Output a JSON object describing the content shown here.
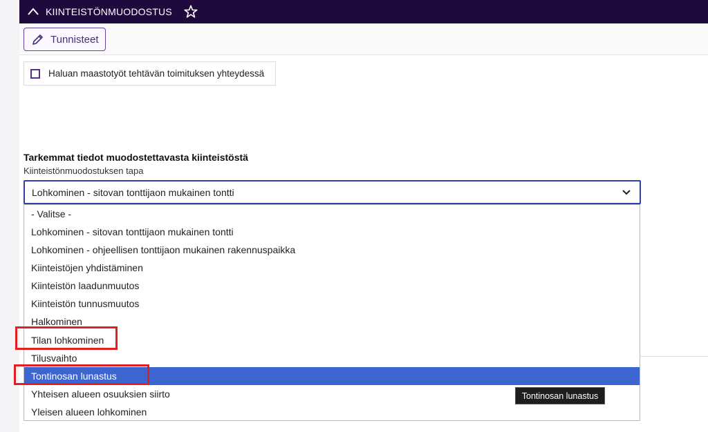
{
  "header": {
    "title": "KIINTEISTÖNMUODOSTUS"
  },
  "toolbar": {
    "tunnisteet_label": "Tunnisteet"
  },
  "checkbox": {
    "label": "Haluan maastotyöt tehtävän toimituksen yhteydessä",
    "checked": false
  },
  "section": {
    "title": "Tarkemmat tiedot muodostettavasta kiinteistöstä",
    "field_label": "Kiinteistönmuodostuksen tapa",
    "selected_value": "Lohkominen - sitovan tonttijaon mukainen tontti"
  },
  "options": [
    "- Valitse -",
    "Lohkominen - sitovan tonttijaon mukainen tontti",
    "Lohkominen - ohjeellisen tonttijaon mukainen rakennuspaikka",
    "Kiinteistöjen yhdistäminen",
    "Kiinteistön laadunmuutos",
    "Kiinteistön tunnusmuutos",
    "Halkominen",
    "Tilan lohkominen",
    "Tilusvaihto",
    "Tontinosan lunastus",
    "Yhteisen alueen osuuksien siirto",
    "Yleisen alueen lohkominen"
  ],
  "highlighted_option": "Tontinosan lunastus",
  "tooltip": {
    "text": "Tontinosan lunastus"
  },
  "colors": {
    "header_bg": "#1f0a3d",
    "accent": "#5a2d91",
    "selection": "#3d65cf",
    "highlight_box": "#e02020"
  }
}
